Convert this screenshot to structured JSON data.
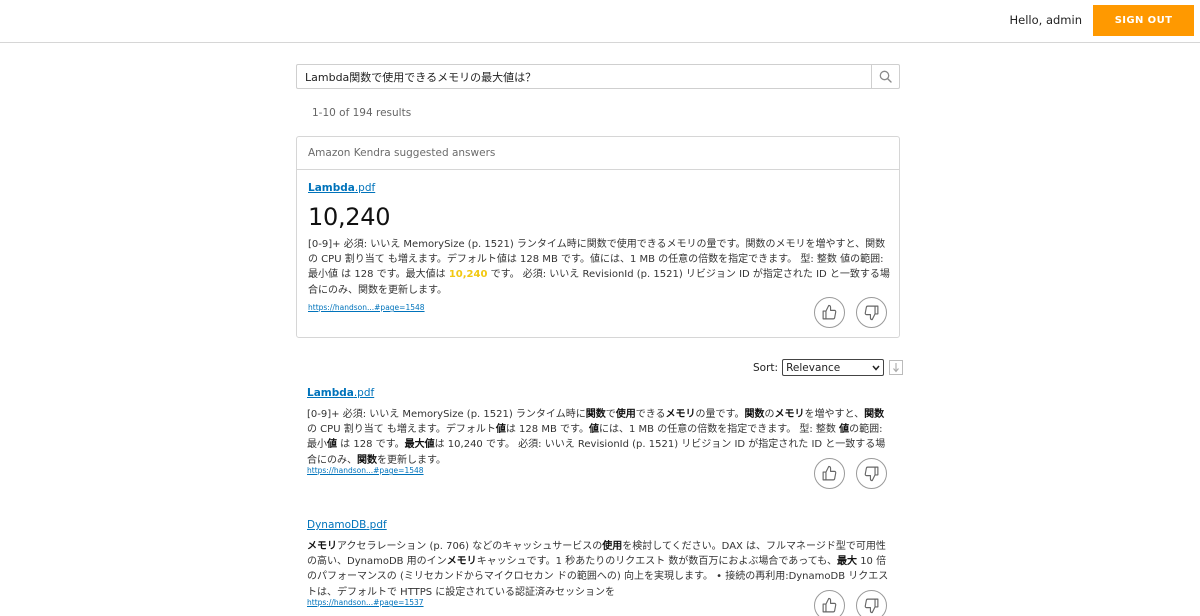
{
  "header": {
    "greeting": "Hello, admin",
    "signout_label": "SIGN OUT",
    "accent": "#ff9900"
  },
  "search": {
    "query": "Lambda関数で使用できるメモリの最大値は？",
    "icon": "search-icon"
  },
  "results_count": "1-10 of 194 results",
  "suggested": {
    "header": "Amazon Kendra suggested answers",
    "doc_name": "Lambda",
    "doc_ext": ".pdf",
    "answer": "10,240",
    "excerpt_before": "[0-9]+ 必須: いいえ MemorySize (p. 1521) ランタイム時に関数で使用できるメモリの量です。関数のメモリを増やすと、関数の CPU 割り当て も増えます。デフォルト値は 128 MB です。値には、1 MB の任意の倍数を指定できます。 型: 整数 値の範囲: 最小値 は 128 です。最大値は ",
    "excerpt_highlight": "10,240",
    "excerpt_after": " です。 必須: いいえ RevisionId (p. 1521) リビジョン ID が指定された ID と一致する場合にのみ、関数を更新します。",
    "source_url": "https://handson...#page=1548"
  },
  "sort": {
    "label": "Sort:",
    "selected": "Relevance"
  },
  "results": [
    {
      "doc_name": "Lambda",
      "doc_ext": ".pdf",
      "excerpt": [
        [
          "[0-9]+ 必須: いいえ MemorySize (p. 1521) ランタイム時に",
          false
        ],
        [
          "関数",
          true
        ],
        [
          "で",
          false
        ],
        [
          "使用",
          true
        ],
        [
          "できる",
          false
        ],
        [
          "メモリ",
          true
        ],
        [
          "の量です。",
          false
        ],
        [
          "関数",
          true
        ],
        [
          "の",
          false
        ],
        [
          "メモリ",
          true
        ],
        [
          "を増やすと、",
          false
        ],
        [
          "関数",
          true
        ],
        [
          "の CPU 割り当て も増えます。デフォルト",
          false
        ],
        [
          "値",
          true
        ],
        [
          "は 128 MB です。",
          false
        ],
        [
          "値",
          true
        ],
        [
          "には、1 MB の任意の倍数を指定できます。 型: 整数 ",
          false
        ],
        [
          "値",
          true
        ],
        [
          "の範囲: 最小",
          false
        ],
        [
          "値",
          true
        ],
        [
          " は 128 です。",
          false
        ],
        [
          "最大値",
          true
        ],
        [
          "は 10,240 です。 必須: いいえ RevisionId (p. 1521) リビジョン ID が指定された ID と一致する場合にのみ、",
          false
        ],
        [
          "関数",
          true
        ],
        [
          "を更新します。",
          false
        ]
      ],
      "source_url": "https://handson...#page=1548"
    },
    {
      "doc_name": "DynamoDB",
      "doc_ext": ".pdf",
      "excerpt": [
        [
          "メモリ",
          true
        ],
        [
          "アクセラレーション (p. 706) などのキャッシュサービスの",
          false
        ],
        [
          "使用",
          true
        ],
        [
          "を検討してください。DAX は、フルマネージド型で可用性の高い、DynamoDB 用のイン",
          false
        ],
        [
          "メモリ",
          true
        ],
        [
          "キャッシュです。1 秒あたりのリクエスト 数が数百万におよぶ場合であっても、",
          false
        ],
        [
          "最大",
          true
        ],
        [
          " 10 倍のパフォーマンスの (ミリセカンドからマイクロセカン ドの範囲への) 向上を実現します。 • 接続の再利用:DynamoDB リクエストは、デフォルトで HTTPS に設定されている認証済みセッションを",
          false
        ]
      ],
      "source_url": "https://handson...#page=1537"
    }
  ],
  "icons": {
    "thumbs_up": "thumbs-up-icon",
    "thumbs_down": "thumbs-down-icon",
    "sort_direction": "arrow-down-icon",
    "dropdown": "chevron-down-icon"
  }
}
